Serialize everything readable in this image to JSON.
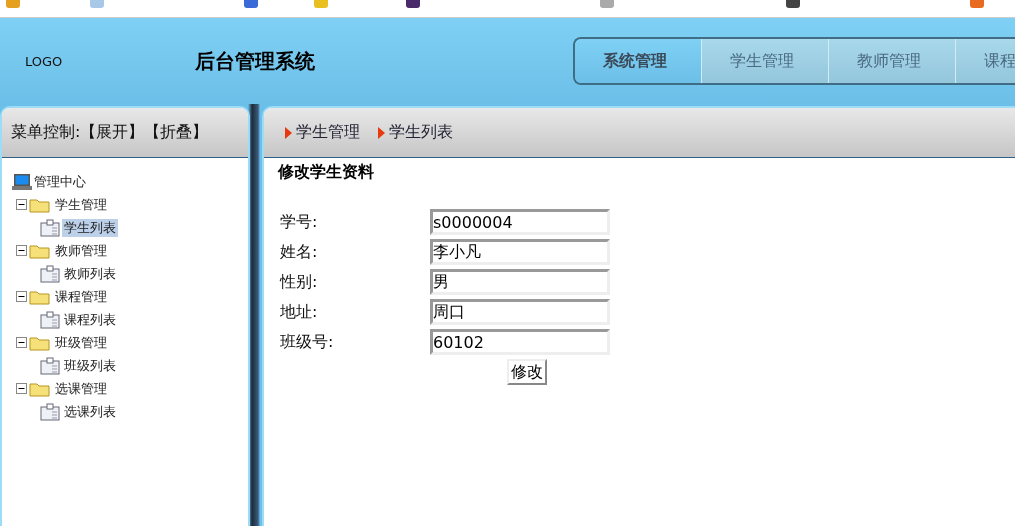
{
  "header": {
    "logo": "LOGO",
    "title": "后台管理系统",
    "tabs": [
      {
        "label": "系统管理",
        "selected": true
      },
      {
        "label": "学生管理",
        "selected": false
      },
      {
        "label": "教师管理",
        "selected": false
      },
      {
        "label": "课程",
        "selected": false
      }
    ]
  },
  "sidebar": {
    "label": "菜单控制:",
    "actions": [
      "【展开】",
      "【折叠】"
    ],
    "tree": {
      "label": "管理中心",
      "children": [
        {
          "label": "学生管理",
          "expanded": true,
          "children": [
            {
              "label": "学生列表",
              "selected": true
            }
          ]
        },
        {
          "label": "教师管理",
          "expanded": true,
          "children": [
            {
              "label": "教师列表",
              "selected": false
            }
          ]
        },
        {
          "label": "课程管理",
          "expanded": true,
          "children": [
            {
              "label": "课程列表",
              "selected": false
            }
          ]
        },
        {
          "label": "班级管理",
          "expanded": true,
          "children": [
            {
              "label": "班级列表",
              "selected": false
            }
          ]
        },
        {
          "label": "选课管理",
          "expanded": true,
          "children": [
            {
              "label": "选课列表",
              "selected": false
            }
          ]
        }
      ]
    }
  },
  "breadcrumb": [
    "学生管理",
    "学生列表"
  ],
  "form": {
    "title": "修改学生资料",
    "fields": [
      {
        "label": "学号:",
        "value": "s0000004"
      },
      {
        "label": "姓名:",
        "value": "李小凡"
      },
      {
        "label": "性别:",
        "value": "男"
      },
      {
        "label": "地址:",
        "value": "周口"
      },
      {
        "label": "班级号:",
        "value": "60102"
      }
    ],
    "submit": "修改"
  }
}
